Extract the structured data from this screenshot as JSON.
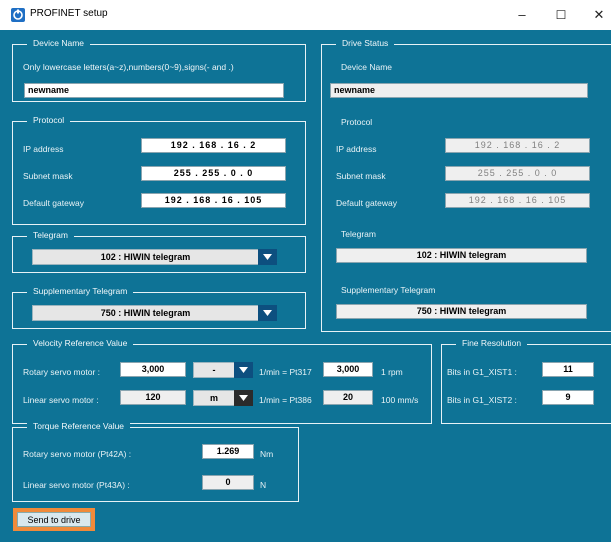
{
  "window": {
    "title": "PROFINET setup",
    "minimize_glyph": "–",
    "maximize_glyph": "☐",
    "close_glyph": "✕"
  },
  "device_name": {
    "legend": "Device Name",
    "hint": "Only lowercase letters(a~z),numbers(0~9),signs(- and .)",
    "value": "newname"
  },
  "protocol": {
    "legend": "Protocol",
    "ip_label": "IP address",
    "ip_value": "192 . 168 . 16 . 2",
    "mask_label": "Subnet mask",
    "mask_value": "255 . 255 . 0 . 0",
    "gateway_label": "Default gateway",
    "gateway_value": "192 . 168 . 16 . 105"
  },
  "telegram": {
    "legend": "Telegram",
    "selected": "102 : HIWIN telegram"
  },
  "supplementary_telegram": {
    "legend": "Supplementary Telegram",
    "selected": "750 : HIWIN telegram"
  },
  "drive_status": {
    "legend": "Drive Status",
    "device_name_label": "Device Name",
    "device_name_value": "newname",
    "protocol_label": "Protocol",
    "ip_label": "IP address",
    "ip_value": "192 . 168 . 16 . 2",
    "mask_label": "Subnet mask",
    "mask_value": "255 . 255 . 0 . 0",
    "gateway_label": "Default gateway",
    "gateway_value": "192 . 168 . 16 . 105",
    "telegram_label": "Telegram",
    "telegram_value": "102 : HIWIN telegram",
    "supp_label": "Supplementary Telegram",
    "supp_value": "750 : HIWIN telegram"
  },
  "velocity": {
    "legend": "Velocity Reference Value",
    "rotary_label": "Rotary servo motor :",
    "rotary_value": "3,000",
    "rotary_unit_select": "-",
    "rotary_eq": "1/min = Pt317",
    "rotary_param": "3,000",
    "rotary_unit": "1 rpm",
    "linear_label": "Linear servo motor :",
    "linear_value": "120",
    "linear_unit_select": "m",
    "linear_eq": "1/min = Pt386",
    "linear_param": "20",
    "linear_unit": "100 mm/s"
  },
  "fine_resolution": {
    "legend": "Fine Resolution",
    "xist1_label": "Bits in G1_XIST1 :",
    "xist1_value": "11",
    "xist2_label": "Bits in G1_XIST2 :",
    "xist2_value": "9"
  },
  "torque": {
    "legend": "Torque Reference Value",
    "rotary_label": "Rotary servo motor (Pt42A) :",
    "rotary_value": "1.269",
    "rotary_unit": "Nm",
    "linear_label": "Linear servo motor (Pt43A) :",
    "linear_value": "0",
    "linear_unit": "N"
  },
  "actions": {
    "send_label": "Send to drive"
  },
  "colors": {
    "background": "#0e7396",
    "dropdown_arrow": "#0d4f7f",
    "highlight": "#f08a3a"
  }
}
